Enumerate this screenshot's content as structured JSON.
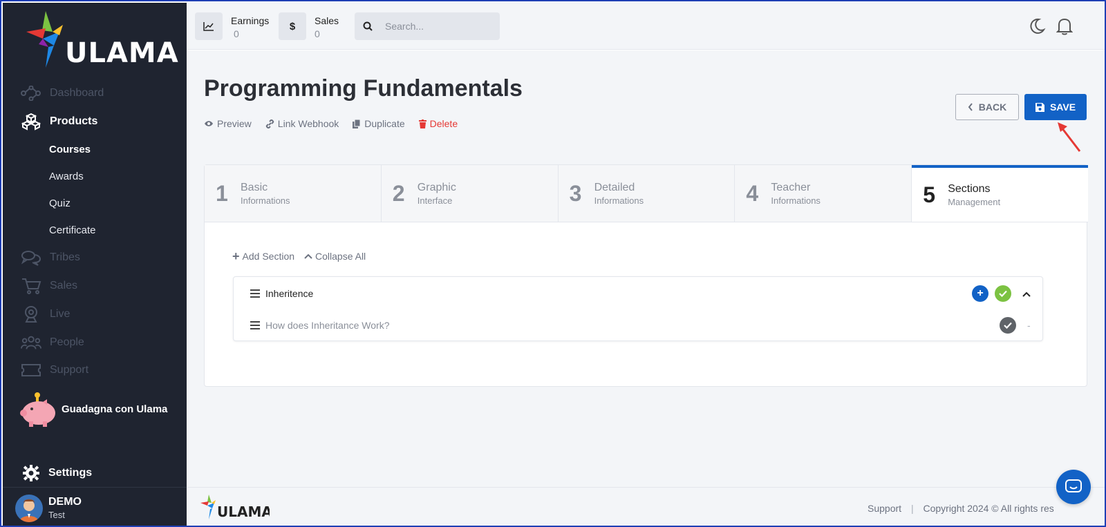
{
  "brand": {
    "name": "ULAMA"
  },
  "sidebar": {
    "items": [
      {
        "label": "Dashboard",
        "icon": "dashboard-network-icon"
      },
      {
        "label": "Products",
        "icon": "cubes-icon"
      },
      {
        "label": "Tribes",
        "icon": "chat-bubbles-icon"
      },
      {
        "label": "Sales",
        "icon": "cart-icon"
      },
      {
        "label": "Live",
        "icon": "webcam-icon"
      },
      {
        "label": "People",
        "icon": "people-icon"
      },
      {
        "label": "Support",
        "icon": "ticket-icon"
      }
    ],
    "sub_items": [
      "Courses",
      "Awards",
      "Quiz",
      "Certificate"
    ],
    "promo_label": "Guadagna con Ulama",
    "settings_label": "Settings",
    "user": {
      "name": "DEMO",
      "sub": "Test"
    }
  },
  "topbar": {
    "earnings_label": "Earnings",
    "earnings_value": "0",
    "sales_label": "Sales",
    "sales_value": "0",
    "search_placeholder": "Search..."
  },
  "page": {
    "title": "Programming Fundamentals",
    "actions": [
      "Preview",
      "Link Webhook",
      "Duplicate",
      "Delete"
    ],
    "back_label": "BACK",
    "save_label": "SAVE"
  },
  "steps": [
    {
      "num": "1",
      "title": "Basic",
      "sub": "Informations"
    },
    {
      "num": "2",
      "title": "Graphic",
      "sub": "Interface"
    },
    {
      "num": "3",
      "title": "Detailed",
      "sub": "Informations"
    },
    {
      "num": "4",
      "title": "Teacher",
      "sub": "Informations"
    },
    {
      "num": "5",
      "title": "Sections",
      "sub": "Management"
    }
  ],
  "sections_toolbar": {
    "add_label": "Add Section",
    "collapse_label": "Collapse All"
  },
  "section": {
    "title": "Inheritence",
    "lesson": "How does Inheritance Work?",
    "lesson_dash": "-"
  },
  "footer": {
    "support": "Support",
    "sep": "|",
    "copyright": "Copyright 2024 © All rights res"
  },
  "colors": {
    "primary": "#1262c6",
    "sidebar_bg": "#1f2430",
    "success": "#7cc242",
    "danger": "#e53935"
  }
}
